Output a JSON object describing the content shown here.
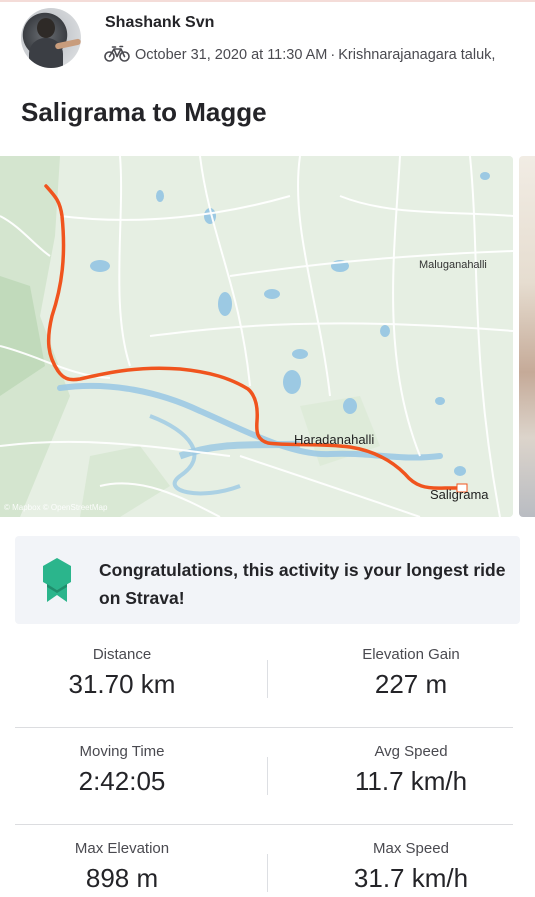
{
  "activity": {
    "athlete_name": "Shashank Svn",
    "date_time": "October 31, 2020 at 11:30 AM",
    "separator": "·",
    "location": "Krishnarajanagara taluk,",
    "sport_icon": "bike-icon",
    "title": "Saligrama to Magge"
  },
  "map": {
    "labels": {
      "village_north": "Maluganahalli",
      "village_middle": "Haradanahalli",
      "village_end": "Saligrama"
    },
    "attribution": "© Mapbox © OpenStreetMap",
    "route_color": "#f0541e",
    "end_marker_color": "#ffffff"
  },
  "achievement": {
    "icon": "badge-icon",
    "text": "Congratulations, this activity is your longest ride on Strava!",
    "icon_color": "#2bb58c"
  },
  "stats": [
    {
      "label": "Distance",
      "value": "31.70 km"
    },
    {
      "label": "Elevation Gain",
      "value": "227 m"
    },
    {
      "label": "Moving Time",
      "value": "2:42:05"
    },
    {
      "label": "Avg Speed",
      "value": "11.7 km/h"
    },
    {
      "label": "Max Elevation",
      "value": "898 m"
    },
    {
      "label": "Max Speed",
      "value": "31.7 km/h"
    }
  ]
}
